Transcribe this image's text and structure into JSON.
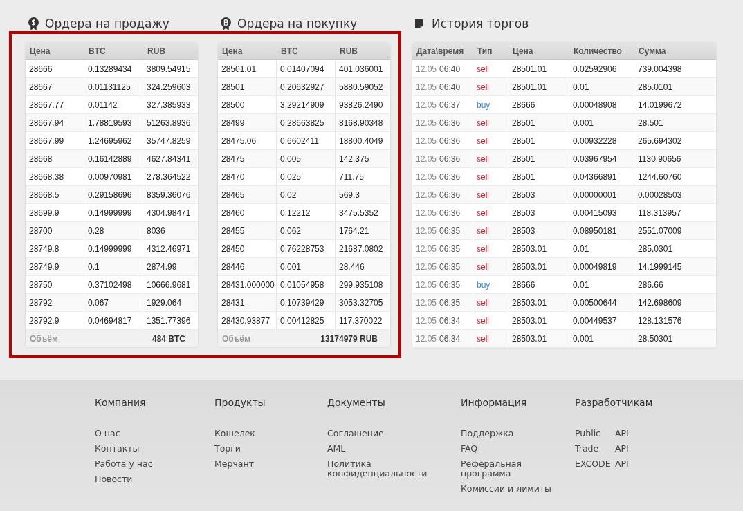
{
  "sell_orders": {
    "title": "Ордера на продажу",
    "columns": [
      "Цена",
      "BTC",
      "RUB"
    ],
    "rows": [
      [
        "28666",
        "0.13289434",
        "3809.54915"
      ],
      [
        "28667",
        "0.01131125",
        "324.259603"
      ],
      [
        "28667.77",
        "0.01142",
        "327.385933"
      ],
      [
        "28667.94",
        "1.78819593",
        "51263.8936"
      ],
      [
        "28667.99",
        "1.24695962",
        "35747.8259"
      ],
      [
        "28668",
        "0.16142889",
        "4627.84341"
      ],
      [
        "28668.38",
        "0.00970981",
        "278.364522"
      ],
      [
        "28668.5",
        "0.29158696",
        "8359.36076"
      ],
      [
        "28699.9",
        "0.14999999",
        "4304.98471"
      ],
      [
        "28700",
        "0.28",
        "8036"
      ],
      [
        "28749.8",
        "0.14999999",
        "4312.46971"
      ],
      [
        "28749.9",
        "0.1",
        "2874.99"
      ],
      [
        "28750",
        "0.37102498",
        "10666.9681"
      ],
      [
        "28792",
        "0.067",
        "1929.064"
      ],
      [
        "28792.9",
        "0.04694817",
        "1351.77396"
      ]
    ],
    "footer": {
      "label": "Объём",
      "value": "484 BTC"
    }
  },
  "buy_orders": {
    "title": "Ордера на покупку",
    "columns": [
      "Цена",
      "BTC",
      "RUB"
    ],
    "rows": [
      [
        "28501.01",
        "0.01407094",
        "401.036001"
      ],
      [
        "28501",
        "0.20632927",
        "5880.59052"
      ],
      [
        "28500",
        "3.29214909",
        "93826.2490"
      ],
      [
        "28499",
        "0.28663825",
        "8168.90348"
      ],
      [
        "28475.06",
        "0.6602411",
        "18800.4049"
      ],
      [
        "28475",
        "0.005",
        "142.375"
      ],
      [
        "28470",
        "0.025",
        "711.75"
      ],
      [
        "28465",
        "0.02",
        "569.3"
      ],
      [
        "28460",
        "0.12212",
        "3475.5352"
      ],
      [
        "28455",
        "0.062",
        "1764.21"
      ],
      [
        "28450",
        "0.76228753",
        "21687.0802"
      ],
      [
        "28446",
        "0.001",
        "28.446"
      ],
      [
        "28431.000000",
        "0.01054958",
        "299.935108"
      ],
      [
        "28431",
        "0.10739429",
        "3053.32705"
      ],
      [
        "28430.93877",
        "0.00412825",
        "117.370022"
      ]
    ],
    "footer": {
      "label": "Объём",
      "value": "13174979 RUB"
    }
  },
  "trade_history": {
    "title": "История торгов",
    "columns": [
      "Дата\\время",
      "Тип",
      "Цена",
      "Количество",
      "Сумма"
    ],
    "rows": [
      {
        "date": "12.05",
        "time": "06:40",
        "type": "sell",
        "color": "#cc2233",
        "price": "28501.01",
        "amount": "0.02592906",
        "total": "739.004398"
      },
      {
        "date": "12.05",
        "time": "06:40",
        "type": "sell",
        "color": "#cc2233",
        "price": "28501.01",
        "amount": "0.01",
        "total": "285.0101"
      },
      {
        "date": "12.05",
        "time": "06:37",
        "type": "buy",
        "color": "#3a86d8",
        "price": "28666",
        "amount": "0.00048908",
        "total": "14.0199672"
      },
      {
        "date": "12.05",
        "time": "06:36",
        "type": "sell",
        "color": "#cc2233",
        "price": "28501",
        "amount": "0.001",
        "total": "28.501"
      },
      {
        "date": "12.05",
        "time": "06:36",
        "type": "sell",
        "color": "#cc2233",
        "price": "28501",
        "amount": "0.00932228",
        "total": "265.694302"
      },
      {
        "date": "12.05",
        "time": "06:36",
        "type": "sell",
        "color": "#cc2233",
        "price": "28501",
        "amount": "0.03967954",
        "total": "1130.90656"
      },
      {
        "date": "12.05",
        "time": "06:36",
        "type": "sell",
        "color": "#cc2233",
        "price": "28501",
        "amount": "0.04366891",
        "total": "1244.60760"
      },
      {
        "date": "12.05",
        "time": "06:36",
        "type": "sell",
        "color": "#cc2233",
        "price": "28503",
        "amount": "0.00000001",
        "total": "0.00028503"
      },
      {
        "date": "12.05",
        "time": "06:36",
        "type": "sell",
        "color": "#cc2233",
        "price": "28503",
        "amount": "0.00415093",
        "total": "118.313957"
      },
      {
        "date": "12.05",
        "time": "06:35",
        "type": "sell",
        "color": "#cc2233",
        "price": "28503",
        "amount": "0.08950181",
        "total": "2551.07009"
      },
      {
        "date": "12.05",
        "time": "06:35",
        "type": "sell",
        "color": "#cc2233",
        "price": "28503.01",
        "amount": "0.01",
        "total": "285.0301"
      },
      {
        "date": "12.05",
        "time": "06:35",
        "type": "sell",
        "color": "#cc2233",
        "price": "28503.01",
        "amount": "0.00049819",
        "total": "14.1999145"
      },
      {
        "date": "12.05",
        "time": "06:35",
        "type": "buy",
        "color": "#3a86d8",
        "price": "28666",
        "amount": "0.01",
        "total": "286.66"
      },
      {
        "date": "12.05",
        "time": "06:35",
        "type": "sell",
        "color": "#cc2233",
        "price": "28503.01",
        "amount": "0.00500644",
        "total": "142.698609"
      },
      {
        "date": "12.05",
        "time": "06:34",
        "type": "sell",
        "color": "#cc2233",
        "price": "28503.01",
        "amount": "0.00449537",
        "total": "128.131576"
      },
      {
        "date": "12.05",
        "time": "06:34",
        "type": "sell",
        "color": "#cc2233",
        "price": "28503.01",
        "amount": "0.001",
        "total": "28.50301"
      }
    ]
  },
  "footer": {
    "columns": [
      {
        "heading": "Компания",
        "links": [
          {
            "text": "О нас"
          },
          {
            "text": "Контакты"
          },
          {
            "text": "Работа у нас"
          },
          {
            "text": "Новости"
          }
        ]
      },
      {
        "heading": "Продукты",
        "links": [
          {
            "text": "Кошелек"
          },
          {
            "text": "Торги"
          },
          {
            "text": "Мерчант"
          }
        ]
      },
      {
        "heading": "Документы",
        "links": [
          {
            "text": "Соглашение"
          },
          {
            "text": "AML"
          },
          {
            "text": "Политика конфиденциальности"
          }
        ]
      },
      {
        "heading": "Информация",
        "links": [
          {
            "text": "Поддержка"
          },
          {
            "text": "FAQ"
          },
          {
            "text": "Реферальная программа"
          },
          {
            "text": "Комиссии и лимиты"
          }
        ]
      },
      {
        "heading": "Разработчикам",
        "links": [
          {
            "text": "Public",
            "suffix": "API"
          },
          {
            "text": "Trade",
            "suffix": "API"
          },
          {
            "text": "EXCODE",
            "suffix": "API"
          }
        ]
      }
    ]
  }
}
